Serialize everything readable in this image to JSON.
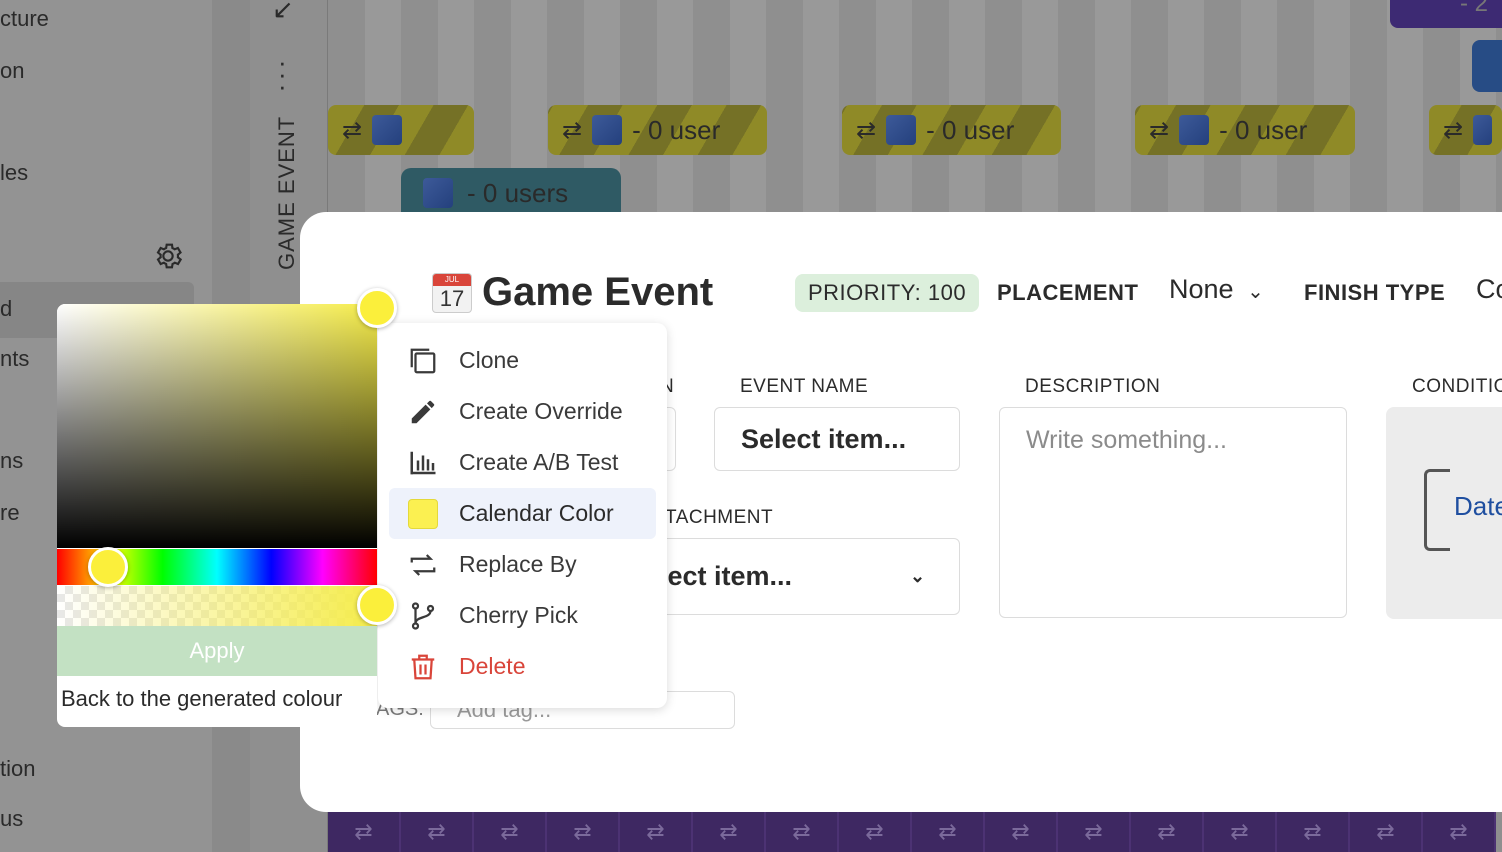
{
  "sidebar": {
    "items": [
      {
        "label": "cture"
      },
      {
        "label": "on"
      },
      {
        "label": "les"
      },
      {
        "label": "d"
      },
      {
        "label": "nts"
      },
      {
        "label": "ns"
      },
      {
        "label": "re"
      },
      {
        "label": "tion"
      },
      {
        "label": "us"
      }
    ],
    "settings_icon": "gear-icon"
  },
  "strip": {
    "title": "GAME EVENT"
  },
  "calendar": {
    "pills": [
      {
        "label": ""
      },
      {
        "label": "- 0 user"
      },
      {
        "label": "- 0 user"
      },
      {
        "label": "- 0 user"
      },
      {
        "label": ""
      }
    ],
    "teal_pill": "- 0 users",
    "top_pill": "- 2"
  },
  "modal": {
    "title": "Game Event",
    "calendar_icon_month": "JUL",
    "calendar_icon_day": "17",
    "priority": "PRIORITY: 100",
    "placement_label": "PLACEMENT",
    "placement_value": "None",
    "finish_type_label": "FINISH TYPE",
    "finish_type_value": "Co",
    "partial_label_1": "N",
    "event_name_label": "EVENT NAME",
    "event_name_value": "Select item...",
    "description_label": "DESCRIPTION",
    "description_placeholder": "Write something...",
    "condition_label": "CONDITIO",
    "condition_value": "Date",
    "attachment_label": "TACHMENT",
    "attachment_value": "lect item...",
    "tags_label": "AGS:",
    "tags_placeholder": "Add tag..."
  },
  "menu": {
    "items": [
      {
        "label": "Clone",
        "icon": "clone-icon"
      },
      {
        "label": "Create Override",
        "icon": "pencil-icon"
      },
      {
        "label": "Create A/B Test",
        "icon": "chart-icon"
      },
      {
        "label": "Calendar Color",
        "icon": "color-swatch"
      },
      {
        "label": "Replace By",
        "icon": "replace-icon"
      },
      {
        "label": "Cherry Pick",
        "icon": "branch-icon"
      },
      {
        "label": "Delete",
        "icon": "trash-icon"
      }
    ]
  },
  "picker": {
    "color": "#f5ec4a",
    "apply_label": "Apply",
    "back_label": "Back to the generated colour"
  }
}
